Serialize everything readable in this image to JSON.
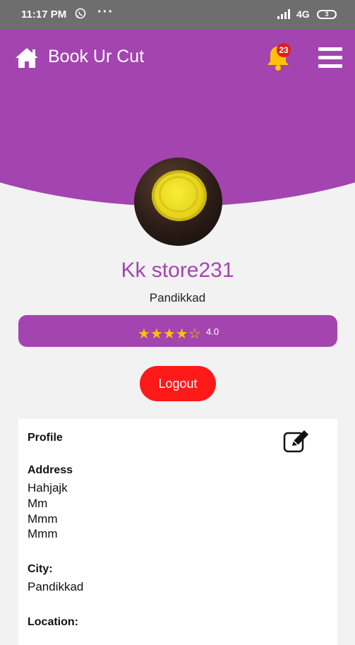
{
  "status_bar": {
    "time": "11:17 PM",
    "dots": "···",
    "network": "4G",
    "battery": "3",
    "icons": [
      "whatsapp-icon",
      "signal-icon"
    ]
  },
  "header": {
    "title": "Book Ur Cut",
    "notification_count": "23",
    "icons": [
      "home-icon",
      "bell-icon",
      "menu-icon"
    ]
  },
  "colors": {
    "brand": "#a444b1",
    "logout": "#ff1a1a",
    "badge": "#e11d1d",
    "star": "#ffc107"
  },
  "profile": {
    "name": "Kk store231",
    "place": "Pandikkad",
    "rating_value": "4.0",
    "rating_stars": "★★★★☆"
  },
  "logout_label": "Logout",
  "card": {
    "section_title": "Profile",
    "address_label": "Address",
    "address_lines": [
      "Hahjajk",
      "Mm",
      "Mmm",
      "Mmm"
    ],
    "city_label": "City:",
    "city_value": "Pandikkad",
    "location_label": "Location:"
  }
}
